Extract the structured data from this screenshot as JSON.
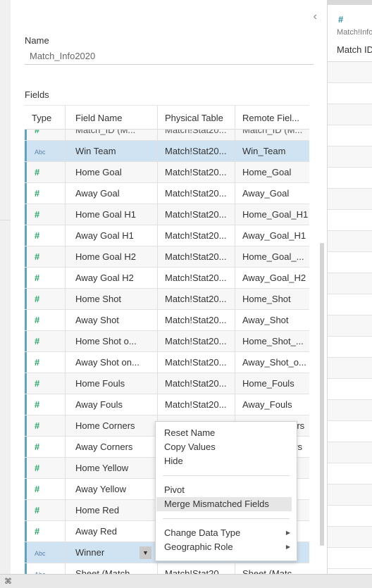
{
  "panel": {
    "collapse_icon": "chevron-left-icon",
    "collapse_glyph": "‹",
    "name_label": "Name",
    "name_value": "Match_Info2020",
    "fields_label": "Fields"
  },
  "table": {
    "headers": [
      "Type",
      "Field Name",
      "Physical Table",
      "Remote Fiel..."
    ],
    "partial_top_row": {
      "field": "Match_ID (M...",
      "table": "Match!Stat20...",
      "remote": "Match_ID (M..."
    },
    "rows": [
      {
        "type": "Abc",
        "field": "Win Team",
        "table": "Match!Stat20...",
        "remote": "Win_Team",
        "selected": true
      },
      {
        "type": "#",
        "field": "Home Goal",
        "table": "Match!Stat20...",
        "remote": "Home_Goal"
      },
      {
        "type": "#",
        "field": "Away Goal",
        "table": "Match!Stat20...",
        "remote": "Away_Goal"
      },
      {
        "type": "#",
        "field": "Home Goal H1",
        "table": "Match!Stat20...",
        "remote": "Home_Goal_H1"
      },
      {
        "type": "#",
        "field": "Away Goal H1",
        "table": "Match!Stat20...",
        "remote": "Away_Goal_H1"
      },
      {
        "type": "#",
        "field": "Home Goal H2",
        "table": "Match!Stat20...",
        "remote": "Home_Goal_..."
      },
      {
        "type": "#",
        "field": "Away Goal H2",
        "table": "Match!Stat20...",
        "remote": "Away_Goal_H2"
      },
      {
        "type": "#",
        "field": "Home Shot",
        "table": "Match!Stat20...",
        "remote": "Home_Shot"
      },
      {
        "type": "#",
        "field": "Away Shot",
        "table": "Match!Stat20...",
        "remote": "Away_Shot"
      },
      {
        "type": "#",
        "field": "Home Shot o...",
        "table": "Match!Stat20...",
        "remote": "Home_Shot_..."
      },
      {
        "type": "#",
        "field": "Away Shot on...",
        "table": "Match!Stat20...",
        "remote": "Away_Shot_o..."
      },
      {
        "type": "#",
        "field": "Home Fouls",
        "table": "Match!Stat20...",
        "remote": "Home_Fouls"
      },
      {
        "type": "#",
        "field": "Away Fouls",
        "table": "Match!Stat20...",
        "remote": "Away_Fouls"
      },
      {
        "type": "#",
        "field": "Home Corners",
        "table": "Match!Stat20...",
        "remote": "Home_Corners"
      },
      {
        "type": "#",
        "field": "Away Corners",
        "table": "Match!Stat20...",
        "remote": "Away_Corners"
      },
      {
        "type": "#",
        "field": "Home Yellow",
        "table": "",
        "remote": ""
      },
      {
        "type": "#",
        "field": "Away Yellow",
        "table": "",
        "remote": ""
      },
      {
        "type": "#",
        "field": "Home Red",
        "table": "",
        "remote": ""
      },
      {
        "type": "#",
        "field": "Away Red",
        "table": "",
        "remote": ""
      },
      {
        "type": "Abc",
        "field": "Winner",
        "table": "",
        "remote": "",
        "selected": true,
        "dropdown": true
      },
      {
        "type": "Abc",
        "field": "Sheet (Match...",
        "table": "Match!Stat20...",
        "remote": "Sheet (Matc..."
      }
    ],
    "dropdown_glyph": "▼"
  },
  "context_menu": {
    "groups": [
      [
        {
          "label": "Reset Name"
        },
        {
          "label": "Copy Values"
        },
        {
          "label": "Hide"
        }
      ],
      [
        {
          "label": "Pivot"
        },
        {
          "label": "Merge Mismatched Fields",
          "highlighted": true
        }
      ],
      [
        {
          "label": "Change Data Type",
          "submenu": true
        },
        {
          "label": "Geographic Role",
          "submenu": true
        }
      ]
    ],
    "submenu_glyph": "▶"
  },
  "right_panel": {
    "type_glyph": "#",
    "source": "Match!Info",
    "column": "Match ID"
  },
  "statusbar": {
    "icon": "book-icon",
    "glyph": "⌘"
  },
  "colors": {
    "selection": "#cfe3f3",
    "accent_bar": "#5ba4c4",
    "number_icon": "#2aa86b",
    "string_icon": "#5a7fa8"
  }
}
